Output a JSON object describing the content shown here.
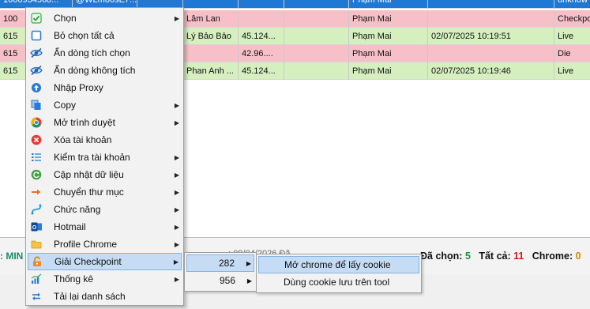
{
  "grid": {
    "rows": [
      {
        "style": "sel",
        "cells": [
          "1000934568...",
          "@WLm80sE7...",
          "",
          "",
          "",
          "",
          "Phạm Mai",
          "",
          "unknow"
        ]
      },
      {
        "style": "pink",
        "cells": [
          "100",
          "",
          "",
          "Lâm Lan",
          "",
          "",
          "Phạm Mai",
          "",
          "Checkpo"
        ]
      },
      {
        "style": "green",
        "cells": [
          "615",
          "",
          "",
          "Lý Bảo Bảo",
          "45.124...",
          "",
          "Phạm Mai",
          "02/07/2025 10:19:51",
          "Live"
        ]
      },
      {
        "style": "pink",
        "cells": [
          "615",
          "",
          "",
          "",
          "42.96....",
          "",
          "Phạm Mai",
          "",
          "Die"
        ]
      },
      {
        "style": "green",
        "cells": [
          "615",
          "",
          "",
          "Phan Anh ...",
          "45.124...",
          "",
          "Phạm Mai",
          "02/07/2025 10:19:46",
          "Live"
        ]
      }
    ]
  },
  "statusbar": {
    "mini": ": MIN",
    "obscured": "...: 09/04/2026  Đã ...",
    "selected_label": "Đã chọn:",
    "selected_value": "5",
    "total_label": "Tất cả:",
    "total_value": "11",
    "chrome_label": "Chrome:",
    "chrome_value": "0"
  },
  "menu": {
    "items": [
      {
        "label": "Chọn",
        "icon": "checkbox-icon",
        "submenu": true
      },
      {
        "label": "Bỏ chọn tất cả",
        "icon": "square-icon",
        "submenu": false
      },
      {
        "label": "Ẩn dòng tích chọn",
        "icon": "eye-hide-icon",
        "submenu": false
      },
      {
        "label": "Ẩn dòng không tích",
        "icon": "eye-hide-icon",
        "submenu": false
      },
      {
        "label": "Nhập Proxy",
        "icon": "upload-circle-icon",
        "submenu": false
      },
      {
        "label": "Copy",
        "icon": "copy-icon",
        "submenu": true
      },
      {
        "label": "Mở trình duyệt",
        "icon": "chrome-icon",
        "submenu": true
      },
      {
        "label": "Xóa tài khoản",
        "icon": "delete-icon",
        "submenu": false
      },
      {
        "label": "Kiểm tra tài khoản",
        "icon": "list-check-icon",
        "submenu": true
      },
      {
        "label": "Cập nhật dữ liệu",
        "icon": "refresh-circle-icon",
        "submenu": true
      },
      {
        "label": "Chuyển thư mục",
        "icon": "move-folder-icon",
        "submenu": true
      },
      {
        "label": "Chức năng",
        "icon": "function-icon",
        "submenu": true
      },
      {
        "label": "Hotmail",
        "icon": "outlook-icon",
        "submenu": true
      },
      {
        "label": "Profile Chrome",
        "icon": "folder-icon",
        "submenu": true
      },
      {
        "label": "Giải Checkpoint",
        "icon": "unlock-icon",
        "submenu": true,
        "highlighted": true
      },
      {
        "label": "Thống kê",
        "icon": "stats-icon",
        "submenu": true
      },
      {
        "label": "Tải lại danh sách",
        "icon": "reload-icon",
        "submenu": false
      }
    ]
  },
  "submenu1": {
    "items": [
      {
        "label": "282",
        "highlighted": true
      },
      {
        "label": "956",
        "highlighted": false
      }
    ]
  },
  "submenu2": {
    "items": [
      {
        "label": "Mở chrome để lấy cookie",
        "highlighted": true
      },
      {
        "label": "Dùng cookie lưu trên tool",
        "highlighted": false
      }
    ]
  },
  "colors": {
    "selected_row": "#1e78d4",
    "pink_row": "#f7c0c9",
    "green_row": "#d6efbf",
    "menu_highlight": "#c5dcf4",
    "green_number": "#169a3c",
    "red_number": "#d21717",
    "orange_number": "#d88400"
  }
}
